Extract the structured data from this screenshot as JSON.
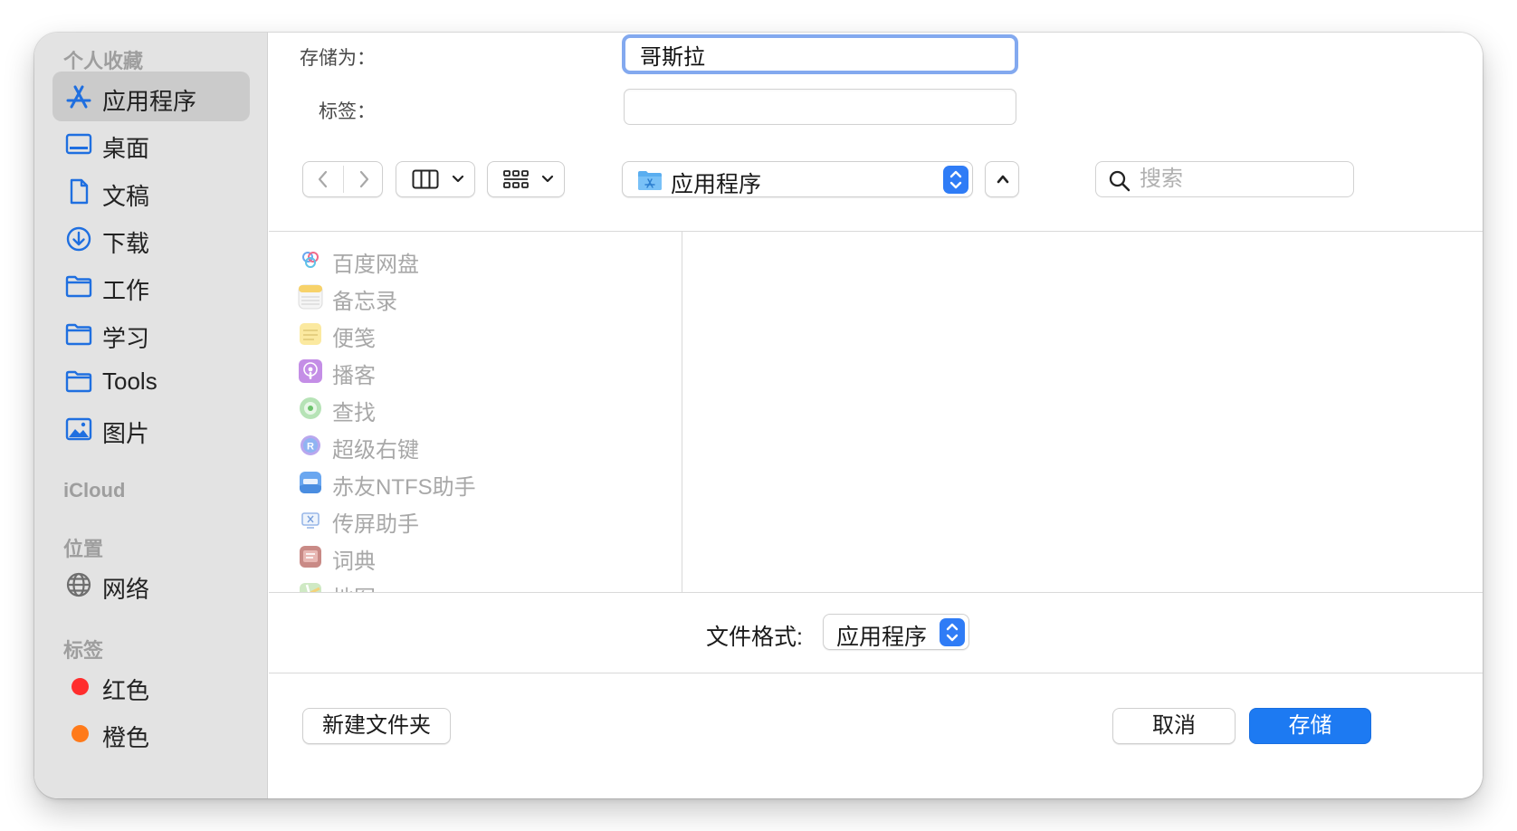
{
  "sidebar": {
    "favorites_header": "个人收藏",
    "favorites": [
      {
        "label": "应用程序",
        "icon": "apps-icon",
        "selected": true
      },
      {
        "label": "桌面",
        "icon": "desktop-icon"
      },
      {
        "label": "文稿",
        "icon": "document-icon"
      },
      {
        "label": "下载",
        "icon": "download-icon"
      },
      {
        "label": "工作",
        "icon": "folder-icon"
      },
      {
        "label": "学习",
        "icon": "folder-icon"
      },
      {
        "label": "Tools",
        "icon": "folder-icon"
      },
      {
        "label": "图片",
        "icon": "photo-icon"
      }
    ],
    "icloud_header": "iCloud",
    "locations_header": "位置",
    "locations": [
      {
        "label": "网络",
        "icon": "network-icon"
      }
    ],
    "tags_header": "标签",
    "tags": [
      {
        "label": "红色",
        "color": "#ff2d2d"
      },
      {
        "label": "橙色",
        "color": "#ff7a1a"
      }
    ]
  },
  "form": {
    "save_as_label": "存储为：",
    "save_as_value": "哥斯拉",
    "tags_label": "标签："
  },
  "toolbar": {
    "back_icon": "chevron-left-icon",
    "forward_icon": "chevron-right-icon",
    "view_icon": "column-view-icon",
    "group_icon": "group-grid-icon",
    "location": "应用程序",
    "search_placeholder": "搜索"
  },
  "files": [
    {
      "label": "百度网盘",
      "icon": "baidu-netdisk-icon"
    },
    {
      "label": "备忘录",
      "icon": "notes-icon"
    },
    {
      "label": "便笺",
      "icon": "stickies-icon"
    },
    {
      "label": "播客",
      "icon": "podcasts-icon"
    },
    {
      "label": "查找",
      "icon": "find-my-icon"
    },
    {
      "label": "超级右键",
      "icon": "super-right-click-icon"
    },
    {
      "label": "赤友NTFS助手",
      "icon": "ntfs-icon"
    },
    {
      "label": "传屏助手",
      "icon": "screen-cast-icon"
    },
    {
      "label": "词典",
      "icon": "dictionary-icon"
    },
    {
      "label": "地图",
      "icon": "maps-icon"
    }
  ],
  "footer": {
    "format_label": "文件格式:",
    "format_value": "应用程序",
    "new_folder": "新建文件夹",
    "cancel": "取消",
    "save": "存储"
  },
  "colors": {
    "accent": "#1d7af2",
    "sidebar_icon": "#1f6fe0",
    "focus_ring": "#83a9ef"
  }
}
